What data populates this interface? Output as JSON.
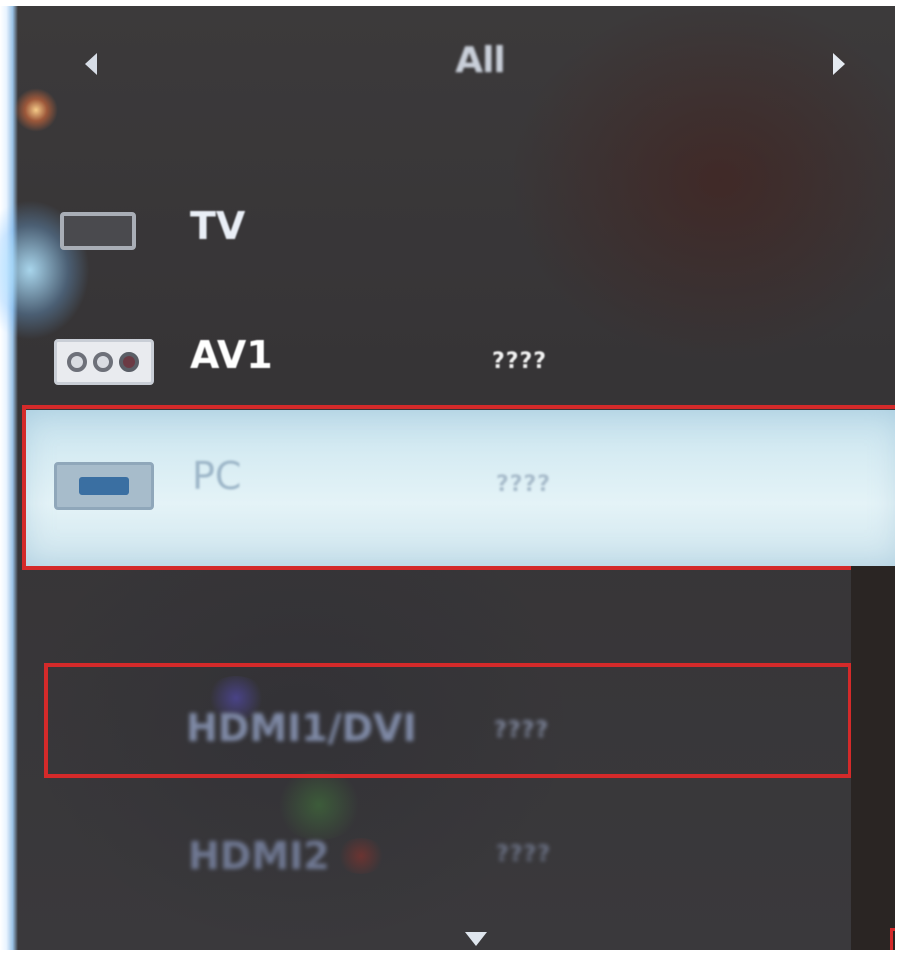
{
  "header": {
    "title": "All",
    "prev_icon": "triangle-left-icon",
    "next_icon": "triangle-right-icon"
  },
  "source_list": {
    "items": [
      {
        "label": "TV",
        "icon": "tv-icon",
        "status": ""
      },
      {
        "label": "AV1",
        "icon": "av-jack-icon",
        "status": "????"
      },
      {
        "label": "PC",
        "icon": "pc-port-icon",
        "status": "????",
        "selected": true
      },
      {
        "label": "HDMI1/DVI",
        "icon": "",
        "status": "????",
        "highlighted": true
      },
      {
        "label": "HDMI2",
        "icon": "",
        "status": "????"
      }
    ],
    "scroll_icon": "chevron-down-icon"
  },
  "colors": {
    "background": "#383639",
    "selection": "#d7ecf3",
    "focus_frame": "#d42a2a",
    "label_active": "#ffffff",
    "label_dimmed": "#7f8aa6"
  }
}
